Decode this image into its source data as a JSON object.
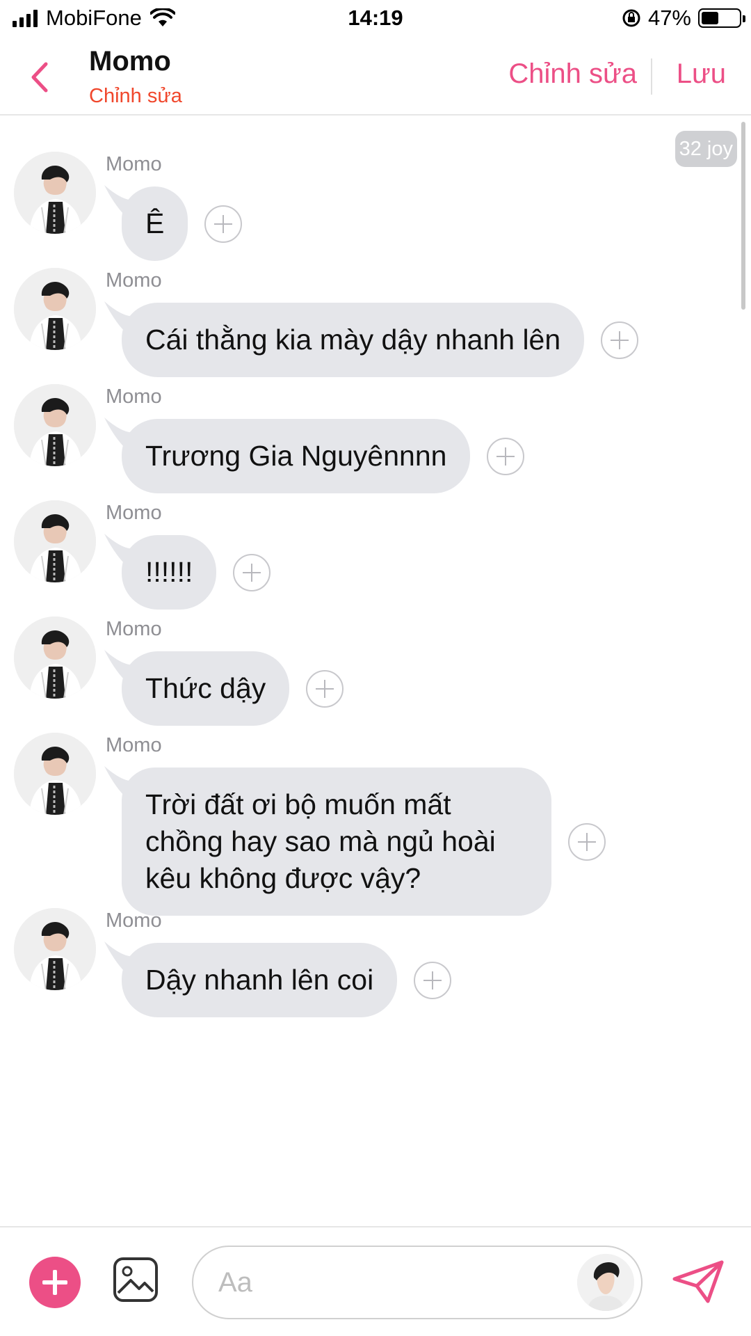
{
  "status_bar": {
    "carrier": "MobiFone",
    "time": "14:19",
    "battery": "47%",
    "battery_level": 0.47
  },
  "header": {
    "title": "Momo",
    "subtitle": "Chỉnh sửa",
    "edit_label": "Chỉnh sửa",
    "save_label": "Lưu",
    "accent_color": "#ec4f86"
  },
  "badge": "32 joy",
  "messages": [
    {
      "sender": "Momo",
      "text": "Ê"
    },
    {
      "sender": "Momo",
      "text": "Cái thằng kia mày dậy nhanh lên"
    },
    {
      "sender": "Momo",
      "text": "Trương Gia Nguyênnnn"
    },
    {
      "sender": "Momo",
      "text": "!!!!!!"
    },
    {
      "sender": "Momo",
      "text": "Thức dậy"
    },
    {
      "sender": "Momo",
      "text": "Trời đất ơi bộ muốn mất chồng hay sao mà ngủ hoài kêu không được vậy?"
    },
    {
      "sender": "Momo",
      "text": "Dậy nhanh lên coi"
    }
  ],
  "composer": {
    "placeholder": "Aa",
    "icons": [
      "plus-icon",
      "image-icon",
      "send-icon"
    ]
  }
}
